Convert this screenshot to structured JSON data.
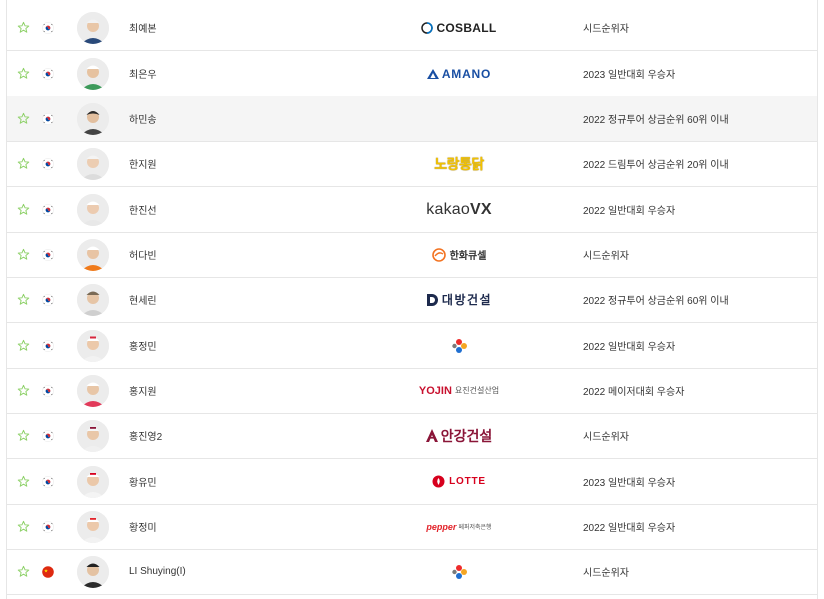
{
  "rows": [
    {
      "name": "최예본",
      "country": "kr",
      "photo_icon": "player-photo-icon",
      "sponsor_icon": "cosball-logo-icon",
      "sponsor_text": "COSBALL",
      "sponsor_sub": "",
      "note": "시드순위자"
    },
    {
      "name": "최은우",
      "country": "kr",
      "photo_icon": "player-photo-icon",
      "sponsor_icon": "amano-logo-icon",
      "sponsor_text": "AMANO",
      "sponsor_sub": "",
      "note": "2023 일반대회 우승자"
    },
    {
      "name": "하민송",
      "country": "kr",
      "photo_icon": "player-photo-icon",
      "sponsor_icon": "",
      "sponsor_text": "",
      "sponsor_sub": "",
      "note": "2022 정규투어 상금순위 60위 이내"
    },
    {
      "name": "한지원",
      "country": "kr",
      "photo_icon": "player-photo-icon",
      "sponsor_icon": "nojang-logo-icon",
      "sponsor_text": "노랑통닭",
      "sponsor_sub": "",
      "note": "2022 드림투어 상금순위 20위 이내"
    },
    {
      "name": "한진선",
      "country": "kr",
      "photo_icon": "player-photo-icon",
      "sponsor_icon": "kakaovx-logo-icon",
      "sponsor_text": "kakao",
      "sponsor_sub": "VX",
      "note": "2022 일반대회 우승자"
    },
    {
      "name": "허다빈",
      "country": "kr",
      "photo_icon": "player-photo-icon",
      "sponsor_icon": "hanwha-logo-icon",
      "sponsor_text": "한화큐셀",
      "sponsor_sub": "",
      "note": "시드순위자"
    },
    {
      "name": "현세린",
      "country": "kr",
      "photo_icon": "player-photo-icon",
      "sponsor_icon": "daebang-logo-icon",
      "sponsor_text": "대방건설",
      "sponsor_sub": "",
      "note": "2022 정규투어 상금순위 60위 이내"
    },
    {
      "name": "홍정민",
      "country": "kr",
      "photo_icon": "player-photo-icon",
      "sponsor_icon": "cj-logo-icon",
      "sponsor_text": "",
      "sponsor_sub": "",
      "note": "2022 일반대회 우승자"
    },
    {
      "name": "홍지원",
      "country": "kr",
      "photo_icon": "player-photo-icon",
      "sponsor_icon": "yojin-logo-icon",
      "sponsor_text": "YOJIN",
      "sponsor_sub": "요진건설산업",
      "note": "2022 메이저대회 우승자"
    },
    {
      "name": "홍진영2",
      "country": "kr",
      "photo_icon": "player-photo-icon",
      "sponsor_icon": "angang-logo-icon",
      "sponsor_text": "안강건설",
      "sponsor_sub": "",
      "note": "시드순위자"
    },
    {
      "name": "황유민",
      "country": "kr",
      "photo_icon": "player-photo-icon",
      "sponsor_icon": "lotte-logo-icon",
      "sponsor_text": "LOTTE",
      "sponsor_sub": "",
      "note": "2023 일반대회 우승자"
    },
    {
      "name": "황정미",
      "country": "kr",
      "photo_icon": "player-photo-icon",
      "sponsor_icon": "pepper-logo-icon",
      "sponsor_text": "pepper",
      "sponsor_sub": "페퍼저축은행",
      "note": "2022 일반대회 우승자"
    },
    {
      "name": "LI Shuying(I)",
      "country": "cn",
      "photo_icon": "player-photo-icon",
      "sponsor_icon": "cj-logo-icon",
      "sponsor_text": "",
      "sponsor_sub": "",
      "note": "시드순위자"
    }
  ],
  "colors": {
    "star_outline": "#8fd16a",
    "border": "#e6e6e6",
    "hover_row": "#f5f5f5",
    "text": "#333333"
  }
}
